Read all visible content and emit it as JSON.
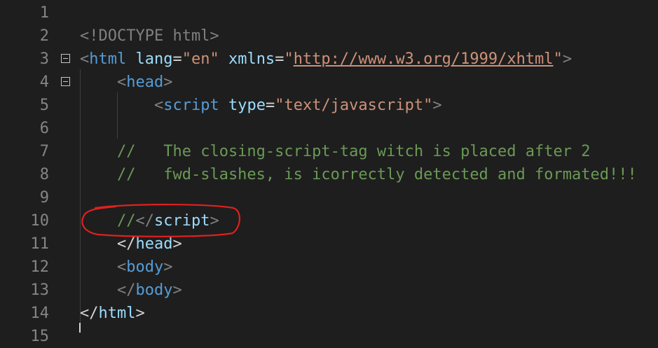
{
  "editor": {
    "lines": [
      {
        "num": "1"
      },
      {
        "num": "2",
        "parts": [
          "<!DOCTYPE html>"
        ]
      },
      {
        "num": "3",
        "parts": [
          "<",
          "html",
          " ",
          "lang",
          "=",
          "\"en\"",
          " ",
          "xmlns",
          "=",
          "\"",
          "http://www.w3.org/1999/xhtml",
          "\"",
          ">"
        ]
      },
      {
        "num": "4",
        "parts": [
          "<",
          "head",
          ">"
        ]
      },
      {
        "num": "5",
        "parts": [
          "<",
          "script",
          " ",
          "type",
          "=",
          "\"text/javascript\"",
          ">"
        ]
      },
      {
        "num": "6"
      },
      {
        "num": "7",
        "comment": "//   The closing-script-tag witch is placed after 2"
      },
      {
        "num": "8",
        "comment": "//   fwd-slashes, is icorrectly detected and formated!!!"
      },
      {
        "num": "9"
      },
      {
        "num": "10",
        "comment": "//",
        "parts": [
          "</",
          "script",
          ">"
        ]
      },
      {
        "num": "11",
        "parts": [
          "</",
          "head",
          ">"
        ]
      },
      {
        "num": "12",
        "parts": [
          "<",
          "body",
          ">"
        ]
      },
      {
        "num": "13",
        "parts": [
          "</",
          "body",
          ">"
        ]
      },
      {
        "num": "14",
        "parts": [
          "</",
          "html",
          ">"
        ]
      },
      {
        "num": "15"
      }
    ]
  },
  "colors": {
    "background": "#1e1e1e",
    "line_number": "#858585",
    "tag": "#569cd6",
    "attribute": "#9cdcfe",
    "string": "#ce9178",
    "comment": "#6a9955",
    "annotation": "#e0201f"
  }
}
